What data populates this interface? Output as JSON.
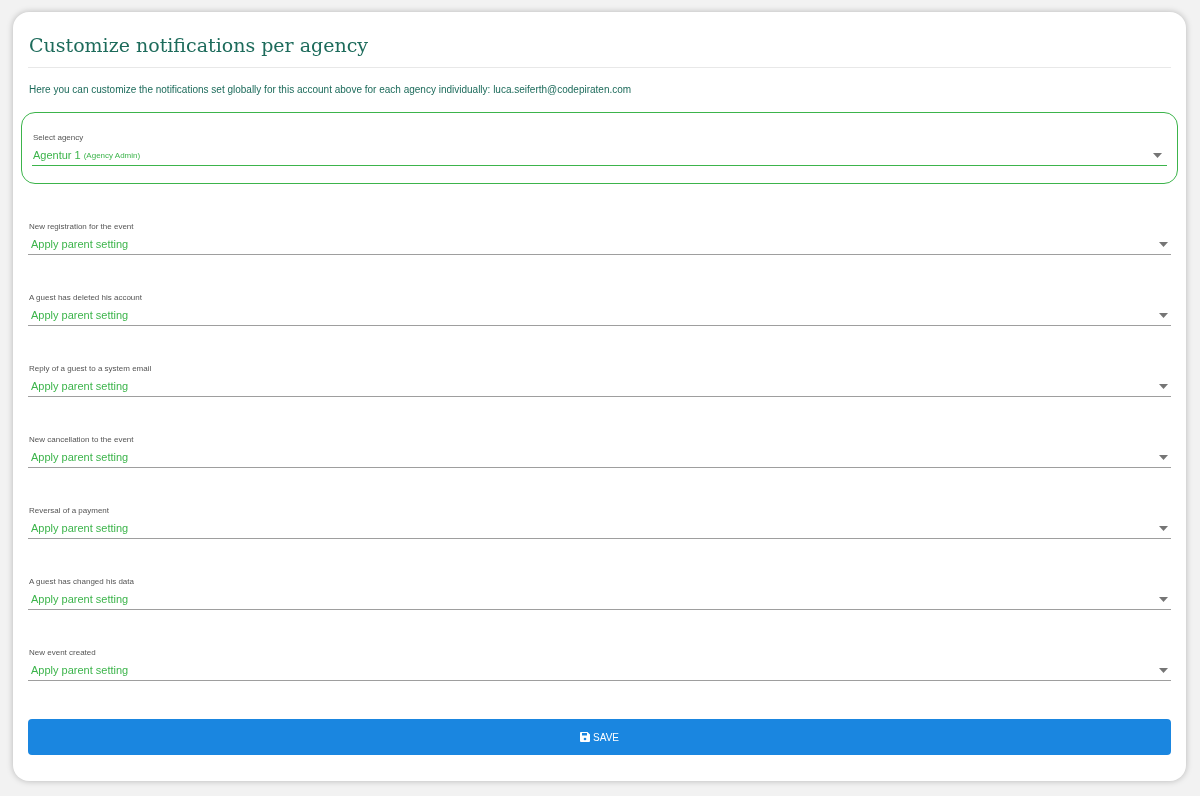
{
  "title": "Customize notifications per agency",
  "description": "Here you can customize the notifications set globally for this account above for each agency individually: luca.seiferth@codepiraten.com",
  "agency_select": {
    "label": "Select agency",
    "value": "Agentur 1",
    "suffix": "(Agency Admin)",
    "highlighted": true
  },
  "settings": [
    {
      "label": "New registration for the event",
      "value": "Apply parent setting"
    },
    {
      "label": "A guest has deleted his account",
      "value": "Apply parent setting"
    },
    {
      "label": "Reply of a guest to a system email",
      "value": "Apply parent setting"
    },
    {
      "label": "New cancellation to the event",
      "value": "Apply parent setting"
    },
    {
      "label": "Reversal of a payment",
      "value": "Apply parent setting"
    },
    {
      "label": "A guest has changed his data",
      "value": "Apply parent setting"
    },
    {
      "label": "New event created",
      "value": "Apply parent setting"
    }
  ],
  "save_button": "SAVE"
}
